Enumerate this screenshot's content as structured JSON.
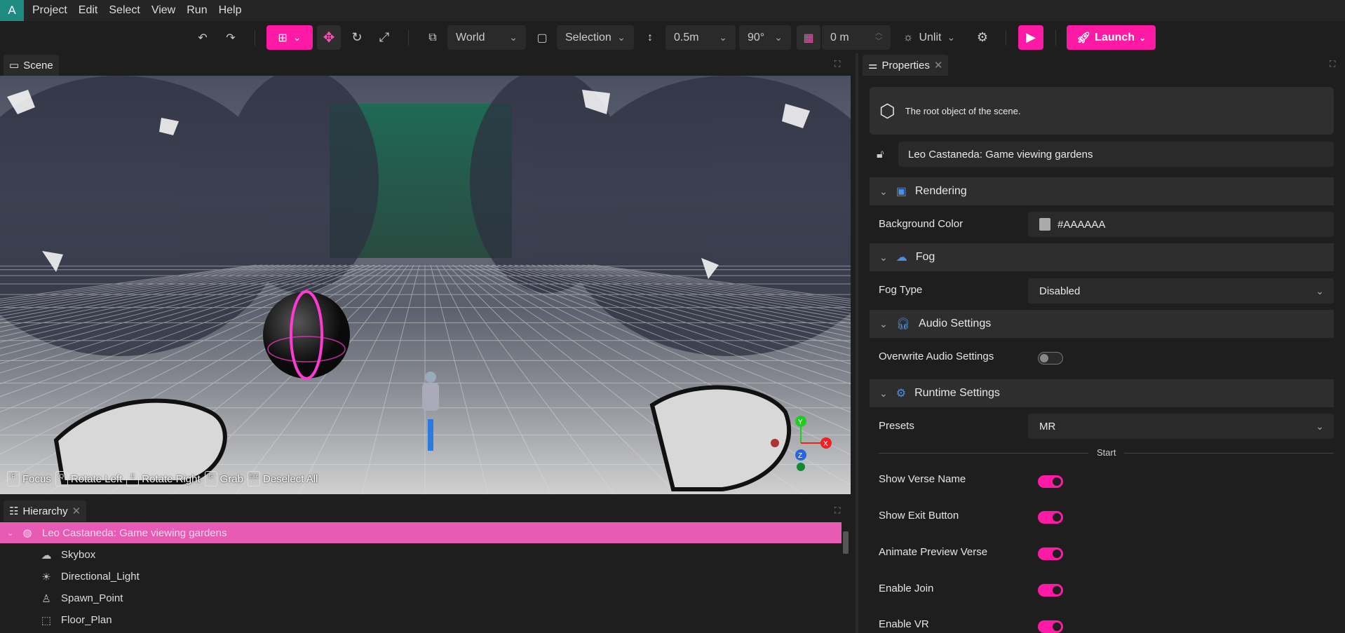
{
  "app": {
    "logo": "A",
    "accent": "#ff1aa6"
  },
  "menu": [
    "Project",
    "Edit",
    "Select",
    "View",
    "Run",
    "Help"
  ],
  "toolbar": {
    "space": "World",
    "pivot": "Selection",
    "snap_move": "0.5m",
    "snap_rotate": "90°",
    "grid_height": "0 m",
    "lighting": "Unlit",
    "launch": "Launch"
  },
  "scene": {
    "tab": "Scene",
    "hints": [
      {
        "key": "F",
        "label": "Focus"
      },
      {
        "key": "Q",
        "label": "Rotate Left"
      },
      {
        "key": "E",
        "label": "Rotate Right"
      },
      {
        "key": "G",
        "label": "Grab"
      },
      {
        "key": "Esc",
        "label": "Deselect All"
      }
    ],
    "gizmo": {
      "x": "X",
      "y": "Y",
      "z": "Z"
    }
  },
  "hierarchy": {
    "tab": "Hierarchy",
    "root": "Leo Castaneda: Game viewing gardens",
    "items": [
      {
        "label": "Skybox",
        "icon": "cloud-sun-icon"
      },
      {
        "label": "Directional_Light",
        "icon": "light-icon"
      },
      {
        "label": "Spawn_Point",
        "icon": "person-icon"
      },
      {
        "label": "Floor_Plan",
        "icon": "floor-plan-icon"
      }
    ]
  },
  "properties": {
    "tab": "Properties",
    "description": "The root object of the scene.",
    "name": "Leo Castaneda: Game viewing gardens",
    "rendering": {
      "title": "Rendering",
      "bg_label": "Background Color",
      "bg_value": "#AAAAAA"
    },
    "fog": {
      "title": "Fog",
      "type_label": "Fog Type",
      "type_value": "Disabled"
    },
    "audio": {
      "title": "Audio Settings",
      "overwrite_label": "Overwrite Audio Settings",
      "overwrite": false
    },
    "runtime": {
      "title": "Runtime Settings",
      "presets_label": "Presets",
      "presets_value": "MR",
      "divider": "Start",
      "toggles": [
        {
          "label": "Show Verse Name",
          "on": true
        },
        {
          "label": "Show Exit Button",
          "on": true
        },
        {
          "label": "Animate Preview Verse",
          "on": true
        },
        {
          "label": "Enable Join",
          "on": true
        },
        {
          "label": "Enable VR",
          "on": true
        }
      ]
    }
  }
}
